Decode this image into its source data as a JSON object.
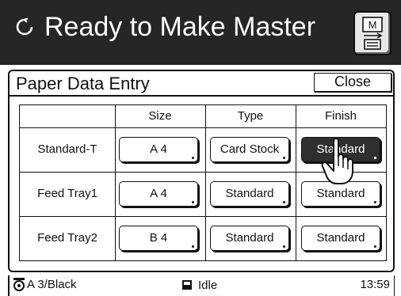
{
  "header": {
    "status_title": "Ready to Make Master",
    "status_icon": "refresh-icon",
    "master_button_icon": "master-document-icon",
    "master_button_label": "M"
  },
  "panel": {
    "title": "Paper Data Entry",
    "close_label": "Close"
  },
  "table": {
    "columns": [
      "",
      "Size",
      "Type",
      "Finish"
    ],
    "rows": [
      {
        "label": "Standard-T",
        "size": "A 4",
        "type": "Card Stock",
        "finish": "Standard",
        "finish_selected": true
      },
      {
        "label": "Feed Tray1",
        "size": "A 4",
        "type": "Standard",
        "finish": "Standard"
      },
      {
        "label": "Feed Tray2",
        "size": "B 4",
        "type": "Standard",
        "finish": "Standard"
      }
    ]
  },
  "status_bar": {
    "drum_info": "A 3/Black",
    "state": "Idle",
    "time": "13:59"
  },
  "colors": {
    "header_bg": "#262626",
    "selected_bg": "#2f2f2f"
  }
}
